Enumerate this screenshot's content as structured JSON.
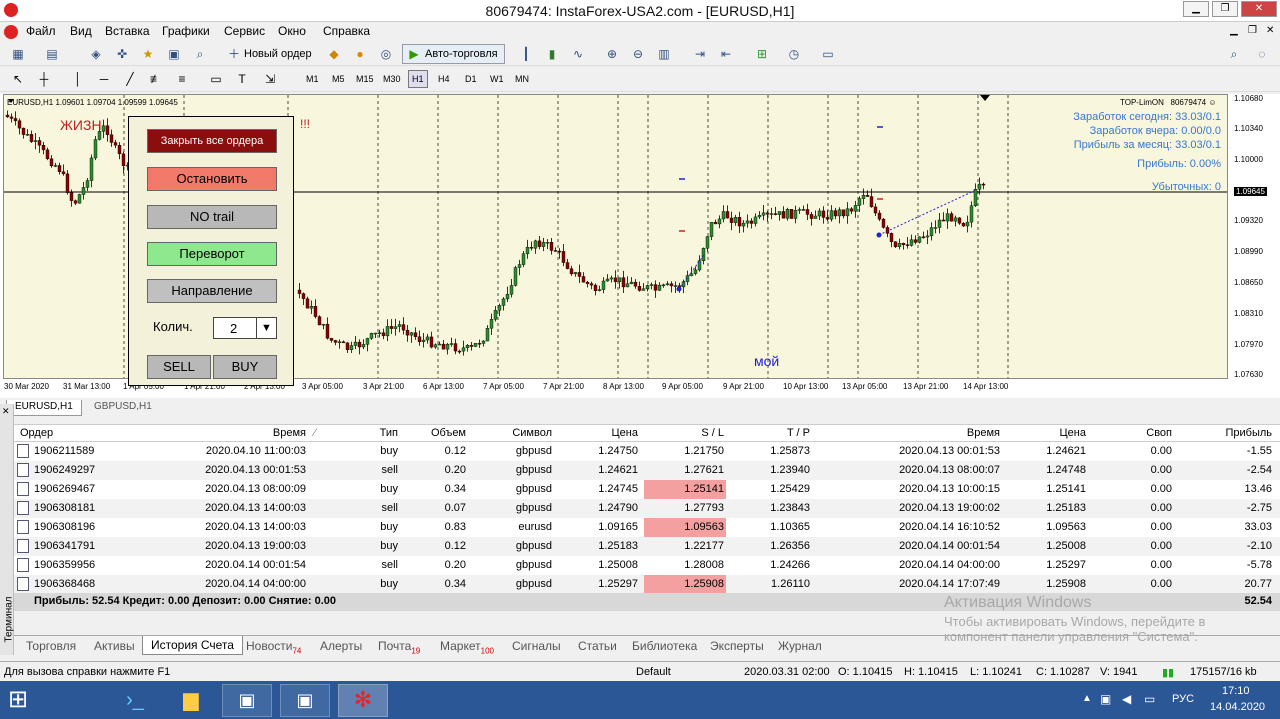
{
  "window": {
    "title": "80679474: InstaForex-USA2.com - [EURUSD,H1]"
  },
  "menu": [
    "Файл",
    "Вид",
    "Вставка",
    "Графики",
    "Сервис",
    "Окно",
    "Справка"
  ],
  "toolbar": {
    "new_order": "Новый ордер",
    "auto_trading": "Авто-торговля"
  },
  "timeframes": [
    "M1",
    "M5",
    "M15",
    "M30",
    "H1",
    "H4",
    "D1",
    "W1",
    "MN"
  ],
  "chart": {
    "symbol_info": "EURUSD,H1  1.09601 1.09704 1.09599 1.09645",
    "indicator": "TOP-LimON",
    "account": "80679474",
    "stats": [
      "Заработок сегодня: 33.03/0.1",
      "Заработок вчера: 0.00/0.0",
      "Прибыль за месяц: 33.03/0.1",
      "Прибыль: 0.00%",
      "Убыточных: 0"
    ],
    "price_label": "1.09645",
    "y_ticks": [
      "1.10680",
      "1.10340",
      "1.10000",
      "1.09645",
      "1.09320",
      "1.08990",
      "1.08650",
      "1.08310",
      "1.07970",
      "1.07630"
    ],
    "x_ticks": [
      "30 Mar 2020",
      "31 Mar 13:00",
      "1 Apr 05:00",
      "1 Apr 21:00",
      "2 Apr 13:00",
      "3 Apr 05:00",
      "3 Apr 21:00",
      "6 Apr 13:00",
      "7 Apr 05:00",
      "7 Apr 21:00",
      "8 Apr 13:00",
      "9 Apr 05:00",
      "9 Apr 21:00",
      "10 Apr 13:00",
      "13 Apr 05:00",
      "13 Apr 21:00",
      "14 Apr 13:00"
    ],
    "text_left": "ЖИЗН",
    "text_excl": "!!!",
    "text_moy": "мой"
  },
  "panel": {
    "close_all": "Закрыть все ордера",
    "stop": "Остановить",
    "no_trail": "NO trail",
    "reverse": "Переворот",
    "direction": "Направление",
    "qty_label": "Колич.",
    "qty_value": "2",
    "sell": "SELL",
    "buy": "BUY"
  },
  "chart_tabs": [
    "EURUSD,H1",
    "GBPUSD,H1"
  ],
  "orders": {
    "headers": [
      "Ордер",
      "Время",
      "Тип",
      "Объем",
      "Символ",
      "Цена",
      "S / L",
      "T / P",
      "Время",
      "Цена",
      "Своп",
      "Прибыль"
    ],
    "rows": [
      [
        "1906211589",
        "2020.04.10 11:00:03",
        "buy",
        "0.12",
        "gbpusd",
        "1.24750",
        "1.21750",
        "1.25873",
        "2020.04.13 00:01:53",
        "1.24621",
        "0.00",
        "-1.55"
      ],
      [
        "1906249297",
        "2020.04.13 00:01:53",
        "sell",
        "0.20",
        "gbpusd",
        "1.24621",
        "1.27621",
        "1.23940",
        "2020.04.13 08:00:07",
        "1.24748",
        "0.00",
        "-2.54"
      ],
      [
        "1906269467",
        "2020.04.13 08:00:09",
        "buy",
        "0.34",
        "gbpusd",
        "1.24745",
        "1.25141",
        "1.25429",
        "2020.04.13 10:00:15",
        "1.25141",
        "0.00",
        "13.46"
      ],
      [
        "1906308181",
        "2020.04.13 14:00:03",
        "sell",
        "0.07",
        "gbpusd",
        "1.24790",
        "1.27793",
        "1.23843",
        "2020.04.13 19:00:02",
        "1.25183",
        "0.00",
        "-2.75"
      ],
      [
        "1906308196",
        "2020.04.13 14:00:03",
        "buy",
        "0.83",
        "eurusd",
        "1.09165",
        "1.09563",
        "1.10365",
        "2020.04.14 16:10:52",
        "1.09563",
        "0.00",
        "33.03"
      ],
      [
        "1906341791",
        "2020.04.13 19:00:03",
        "buy",
        "0.12",
        "gbpusd",
        "1.25183",
        "1.22177",
        "1.26356",
        "2020.04.14 00:01:54",
        "1.25008",
        "0.00",
        "-2.10"
      ],
      [
        "1906359956",
        "2020.04.14 00:01:54",
        "sell",
        "0.20",
        "gbpusd",
        "1.25008",
        "1.28008",
        "1.24266",
        "2020.04.14 04:00:00",
        "1.25297",
        "0.00",
        "-5.78"
      ],
      [
        "1906368468",
        "2020.04.14 04:00:00",
        "buy",
        "0.34",
        "gbpusd",
        "1.25297",
        "1.25908",
        "1.26110",
        "2020.04.14 17:07:49",
        "1.25908",
        "0.00",
        "20.77"
      ]
    ],
    "highlight_rows": [
      2,
      4,
      7
    ],
    "summary": "Прибыль: 52.54  Кредит: 0.00  Депозит: 0.00  Снятие: 0.00",
    "summary_total": "52.54"
  },
  "terminal_label": "Терминал",
  "terminal_tabs": [
    "Торговля",
    "Активы",
    "История Счета",
    "Новости",
    "Алерты",
    "Почта",
    "Маркет",
    "Сигналы",
    "Статьи",
    "Библиотека",
    "Эксперты",
    "Журнал"
  ],
  "tab_badges": {
    "news": "74",
    "mail": "19",
    "market": "100"
  },
  "activation": {
    "title": "Активация Windows",
    "line1": "Чтобы активировать Windows, перейдите в",
    "line2": "компонент панели управления \"Система\"."
  },
  "status": {
    "help": "Для вызова справки нажмите F1",
    "profile": "Default",
    "datetime": "2020.03.31 02:00",
    "open": "O: 1.10415",
    "high": "H: 1.10415",
    "low": "L: 1.10241",
    "close": "C: 1.10287",
    "volume": "V: 1941",
    "traffic": "175157/16 kb"
  },
  "taskbar": {
    "lang": "РУС",
    "time": "17:10",
    "date": "14.04.2020"
  }
}
